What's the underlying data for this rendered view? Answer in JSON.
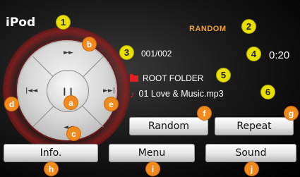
{
  "header": {
    "title": "iPod",
    "mode_status": "RANDOM"
  },
  "player": {
    "track_counter": "001/002",
    "elapsed_time": "0:20",
    "folder_name": "ROOT FOLDER",
    "file_name": "01 Love & Music.mp3"
  },
  "wheel": {
    "center_glyph": "❙❙",
    "up_glyph": "►►",
    "down_glyph": "◄◄",
    "left_glyph": "|◄◄",
    "right_glyph": "►►|"
  },
  "buttons": {
    "random": "Random",
    "repeat": "Repeat",
    "info": "Info.",
    "menu": "Menu",
    "sound": "Sound"
  },
  "callouts": {
    "n1": "1",
    "n2": "2",
    "n3": "3",
    "n4": "4",
    "n5": "5",
    "n6": "6",
    "a": "a",
    "b": "b",
    "c": "c",
    "d": "d",
    "e": "e",
    "f": "f",
    "g": "g",
    "h": "h",
    "i": "i",
    "j": "j"
  },
  "colors": {
    "status_accent": "#f0a030",
    "callout_number": "#e8e000",
    "callout_letter": "#f08a1c",
    "icon_red": "#e02020"
  },
  "icons": {
    "folder": "folder-icon",
    "file": "music-note-icon"
  }
}
